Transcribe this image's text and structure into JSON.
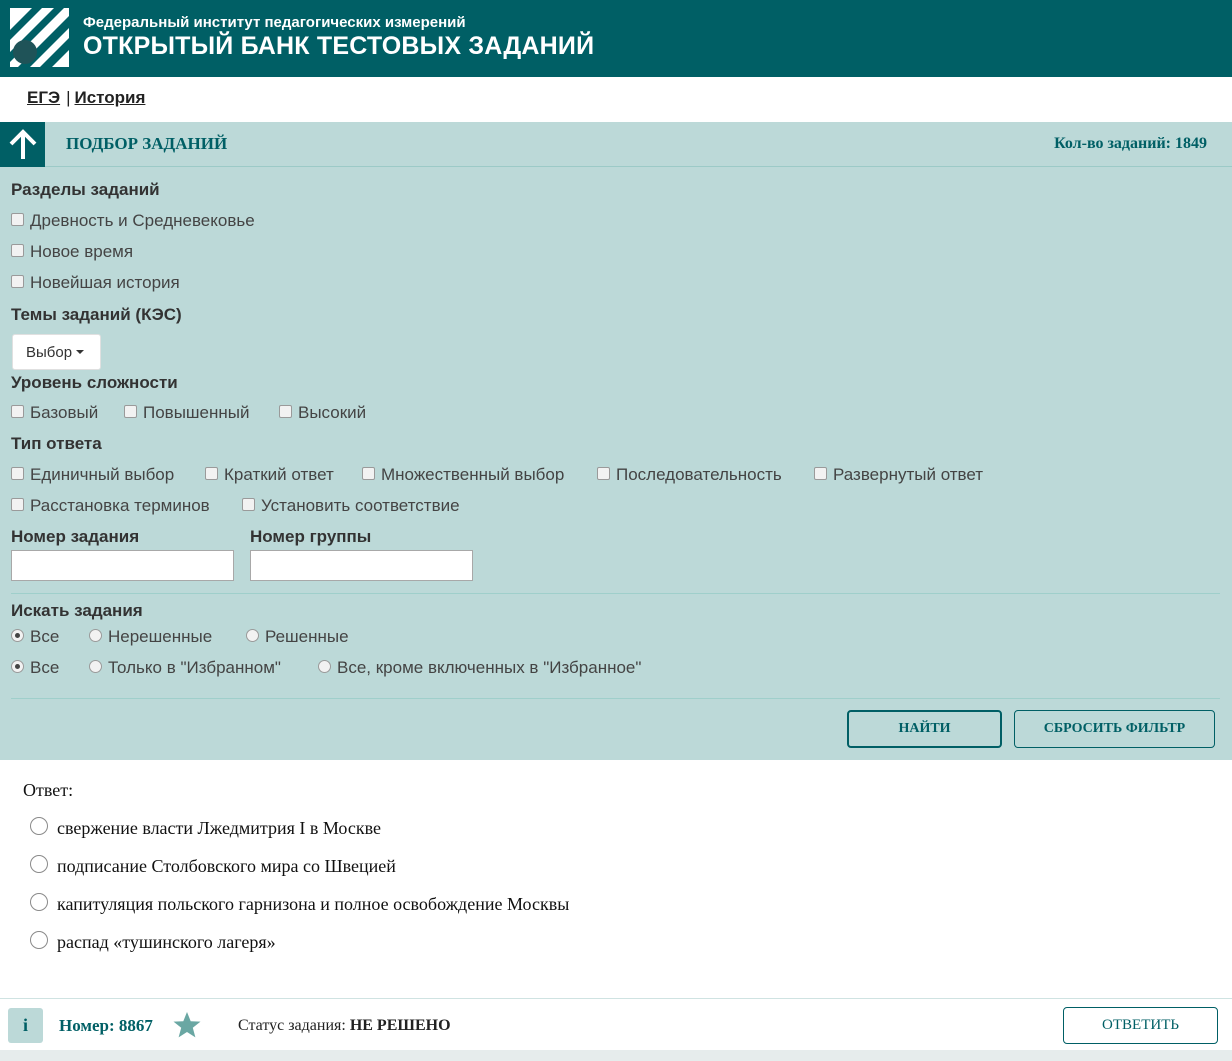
{
  "header": {
    "subtitle": "Федеральный институт педагогических измерений",
    "title": "ОТКРЫТЫЙ БАНК ТЕСТОВЫХ ЗАДАНИЙ"
  },
  "breadcrumb": {
    "exam": "ЕГЭ",
    "separator": "|",
    "subject": "История"
  },
  "filter": {
    "title": "ПОДБОР ЗАДАНИЙ",
    "count": "Кол-во заданий: 1849",
    "sections_label": "Разделы заданий",
    "sections": [
      "Древность и Средневековье",
      "Новое время",
      "Новейшая история"
    ],
    "topics_label": "Темы заданий (КЭС)",
    "topics_select": "Выбор",
    "level_label": "Уровень сложности",
    "levels": [
      "Базовый",
      "Повышенный",
      "Высокий"
    ],
    "answer_type_label": "Тип ответа",
    "answer_types": [
      "Единичный выбор",
      "Краткий ответ",
      "Множественный выбор",
      "Последовательность",
      "Развернутый ответ",
      "Расстановка терминов",
      "Установить соответствие"
    ],
    "task_number_label": "Номер задания",
    "task_number_value": "",
    "group_number_label": "Номер группы",
    "group_number_value": "",
    "search_label": "Искать задания",
    "solved_options": [
      "Все",
      "Нерешенные",
      "Решенные"
    ],
    "solved_selected": "Все",
    "favorite_options": [
      "Все",
      "Только в \"Избранном\"",
      "Все, кроме включенных в \"Избранное\""
    ],
    "favorite_selected": "Все",
    "find_button": "НАЙТИ",
    "reset_button": "СБРОСИТЬ ФИЛЬТР"
  },
  "answer": {
    "label": "Ответ:",
    "options": [
      "свержение власти Лжедмитрия I в Москве",
      "подписание Столбовского мира со Швецией",
      "капитуляция польского гарнизона и полное освобождение Москвы",
      "распад «тушинского лагеря»"
    ]
  },
  "footer": {
    "info": "i",
    "number": "Номер: 8867",
    "status_label": "Статус задания:",
    "status_value": "НЕ РЕШЕНО",
    "answer_button": "ОТВЕТИТЬ"
  },
  "colors": {
    "brand": "#005f65",
    "panel": "#bcd9d8"
  },
  "icons": [
    "logo-icon",
    "arrow-up-icon",
    "chevron-down-icon",
    "star-icon",
    "info-icon"
  ]
}
